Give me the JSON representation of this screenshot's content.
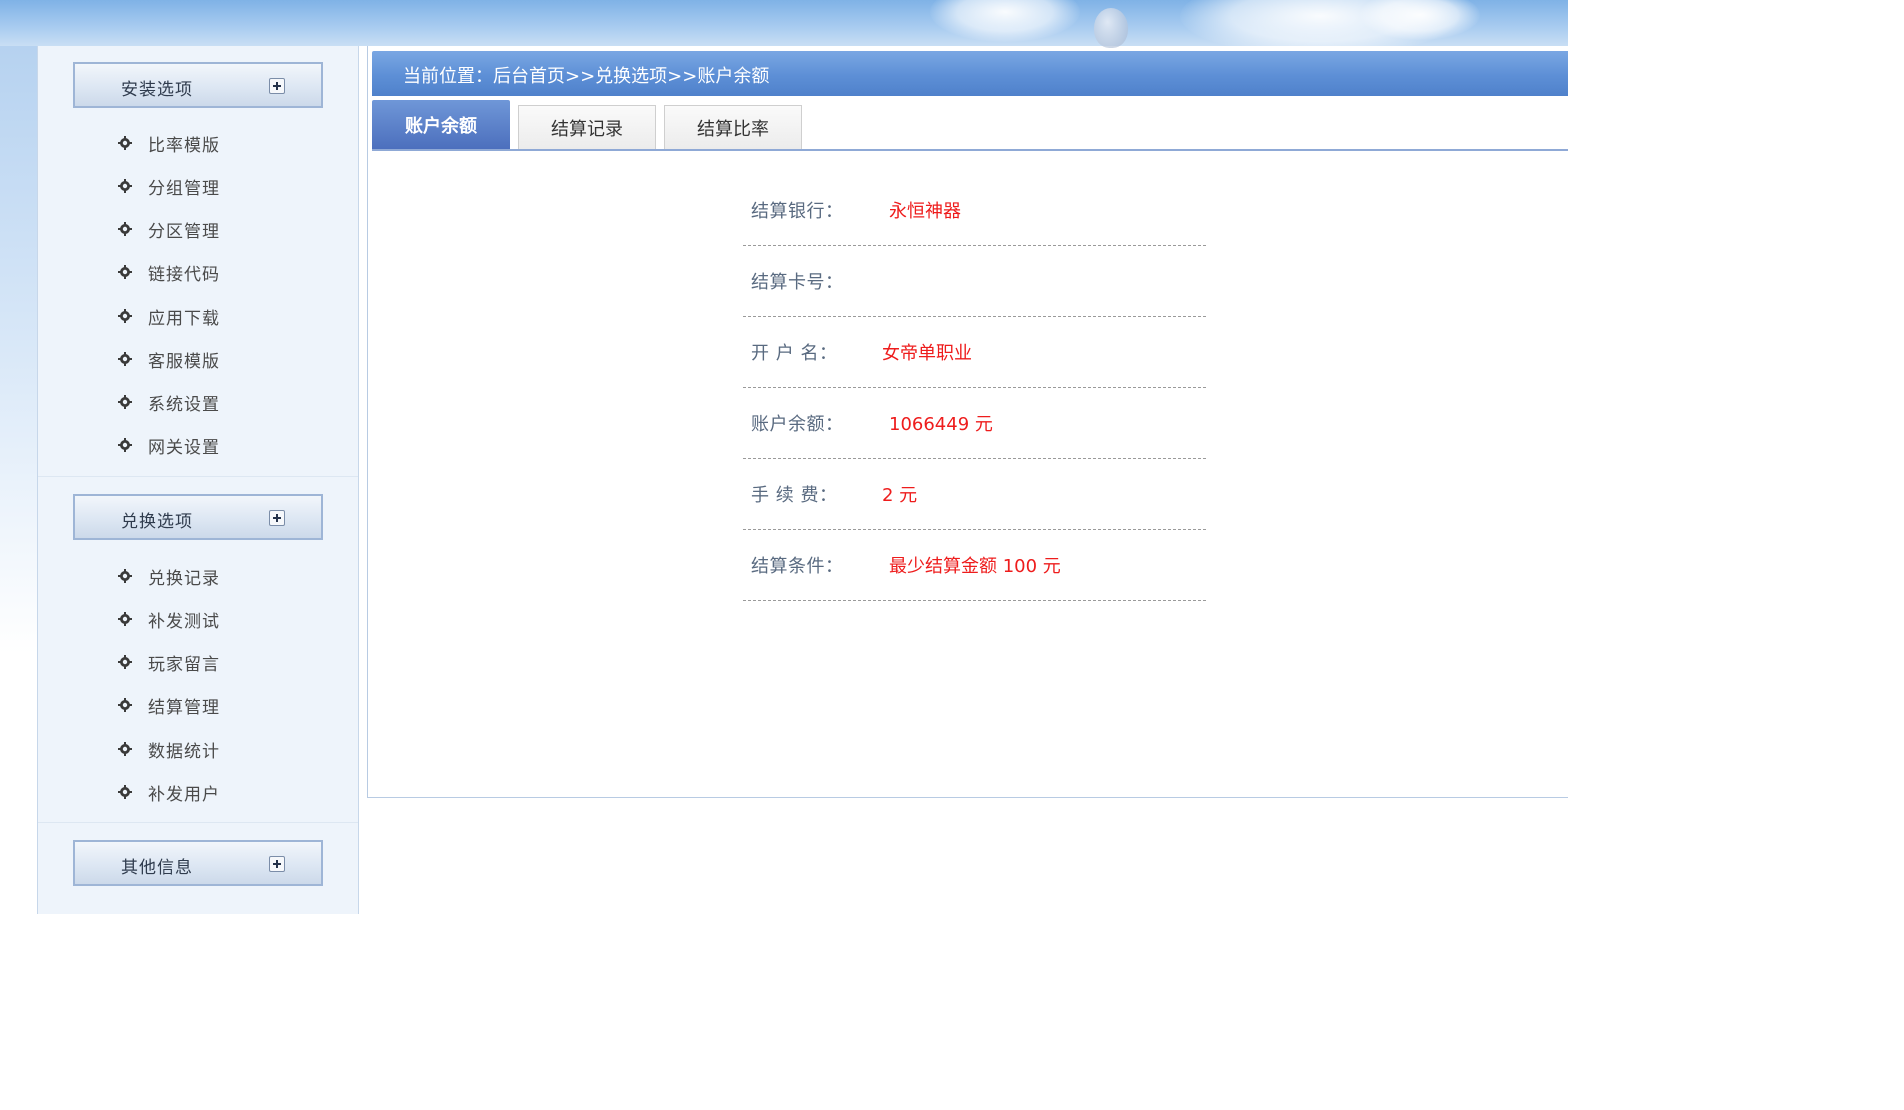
{
  "sidebar": {
    "sections": [
      {
        "title": "安装选项",
        "items": [
          "比率模版",
          "分组管理",
          "分区管理",
          "链接代码",
          "应用下载",
          "客服模版",
          "系统设置",
          "网关设置"
        ]
      },
      {
        "title": "兑换选项",
        "items": [
          "兑换记录",
          "补发测试",
          "玩家留言",
          "结算管理",
          "数据统计",
          "补发用户"
        ]
      },
      {
        "title": "其他信息",
        "items": []
      }
    ]
  },
  "breadcrumb": "当前位置：后台首页>>兑换选项>>账户余额",
  "tabs": [
    {
      "label": "账户余额",
      "active": true
    },
    {
      "label": "结算记录",
      "active": false
    },
    {
      "label": "结算比率",
      "active": false
    }
  ],
  "account": {
    "rows": [
      {
        "key": "结算银行：",
        "value": "永恒神器"
      },
      {
        "key": "结算卡号：",
        "value": ""
      },
      {
        "key": "开 户 名：",
        "value": "女帝单职业"
      },
      {
        "key": "账户余额：",
        "value": "1066449 元"
      },
      {
        "key": "手 续 费：",
        "value": "2 元"
      },
      {
        "key": "结算条件：",
        "value": "最少结算金额 100 元"
      }
    ]
  },
  "colors": {
    "accent": "#4f81cb",
    "value_red": "#ee1c1c",
    "key_gray": "#596a80"
  },
  "icons": {
    "menu_bullet": "gear-icon",
    "section_toggle": "plus-box-icon"
  }
}
